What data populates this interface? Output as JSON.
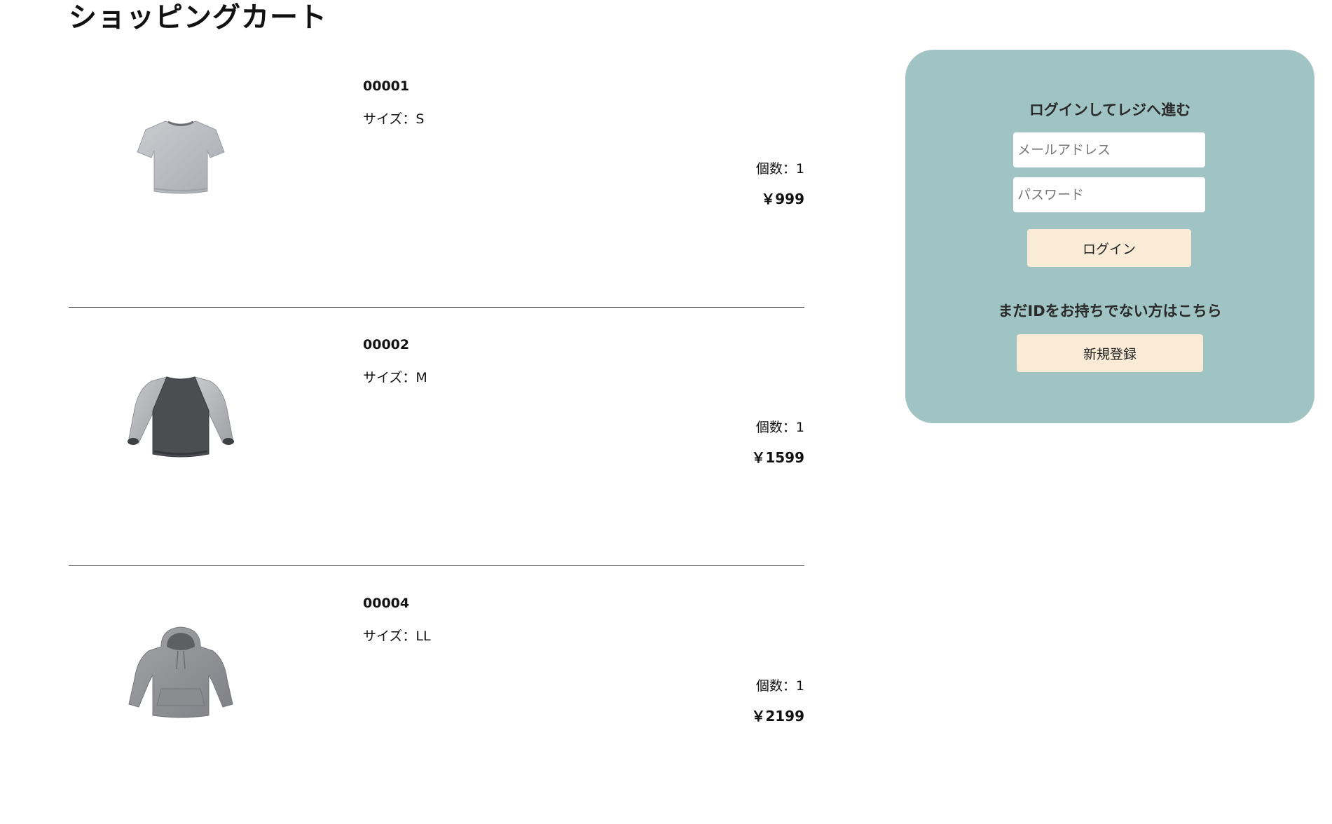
{
  "page": {
    "title": "ショッピングカート"
  },
  "cart": {
    "items": [
      {
        "id": "00001",
        "size": "サイズ：S",
        "quantity": "個数：1",
        "price": "￥999",
        "image_icon": "tshirt-icon"
      },
      {
        "id": "00002",
        "size": "サイズ：M",
        "quantity": "個数：1",
        "price": "￥1599",
        "image_icon": "raglan-sweatshirt-icon"
      },
      {
        "id": "00004",
        "size": "サイズ：LL",
        "quantity": "個数：1",
        "price": "￥2199",
        "image_icon": "hoodie-icon"
      }
    ]
  },
  "login_panel": {
    "heading": "ログインしてレジへ進む",
    "email_placeholder": "メールアドレス",
    "password_placeholder": "パスワード",
    "login_label": "ログイン",
    "signup_prompt": "まだIDをお持ちでない方はこちら",
    "signup_label": "新規登録",
    "colors": {
      "panel_background": "#a0c4c4",
      "button_background": "#faebd6"
    }
  }
}
